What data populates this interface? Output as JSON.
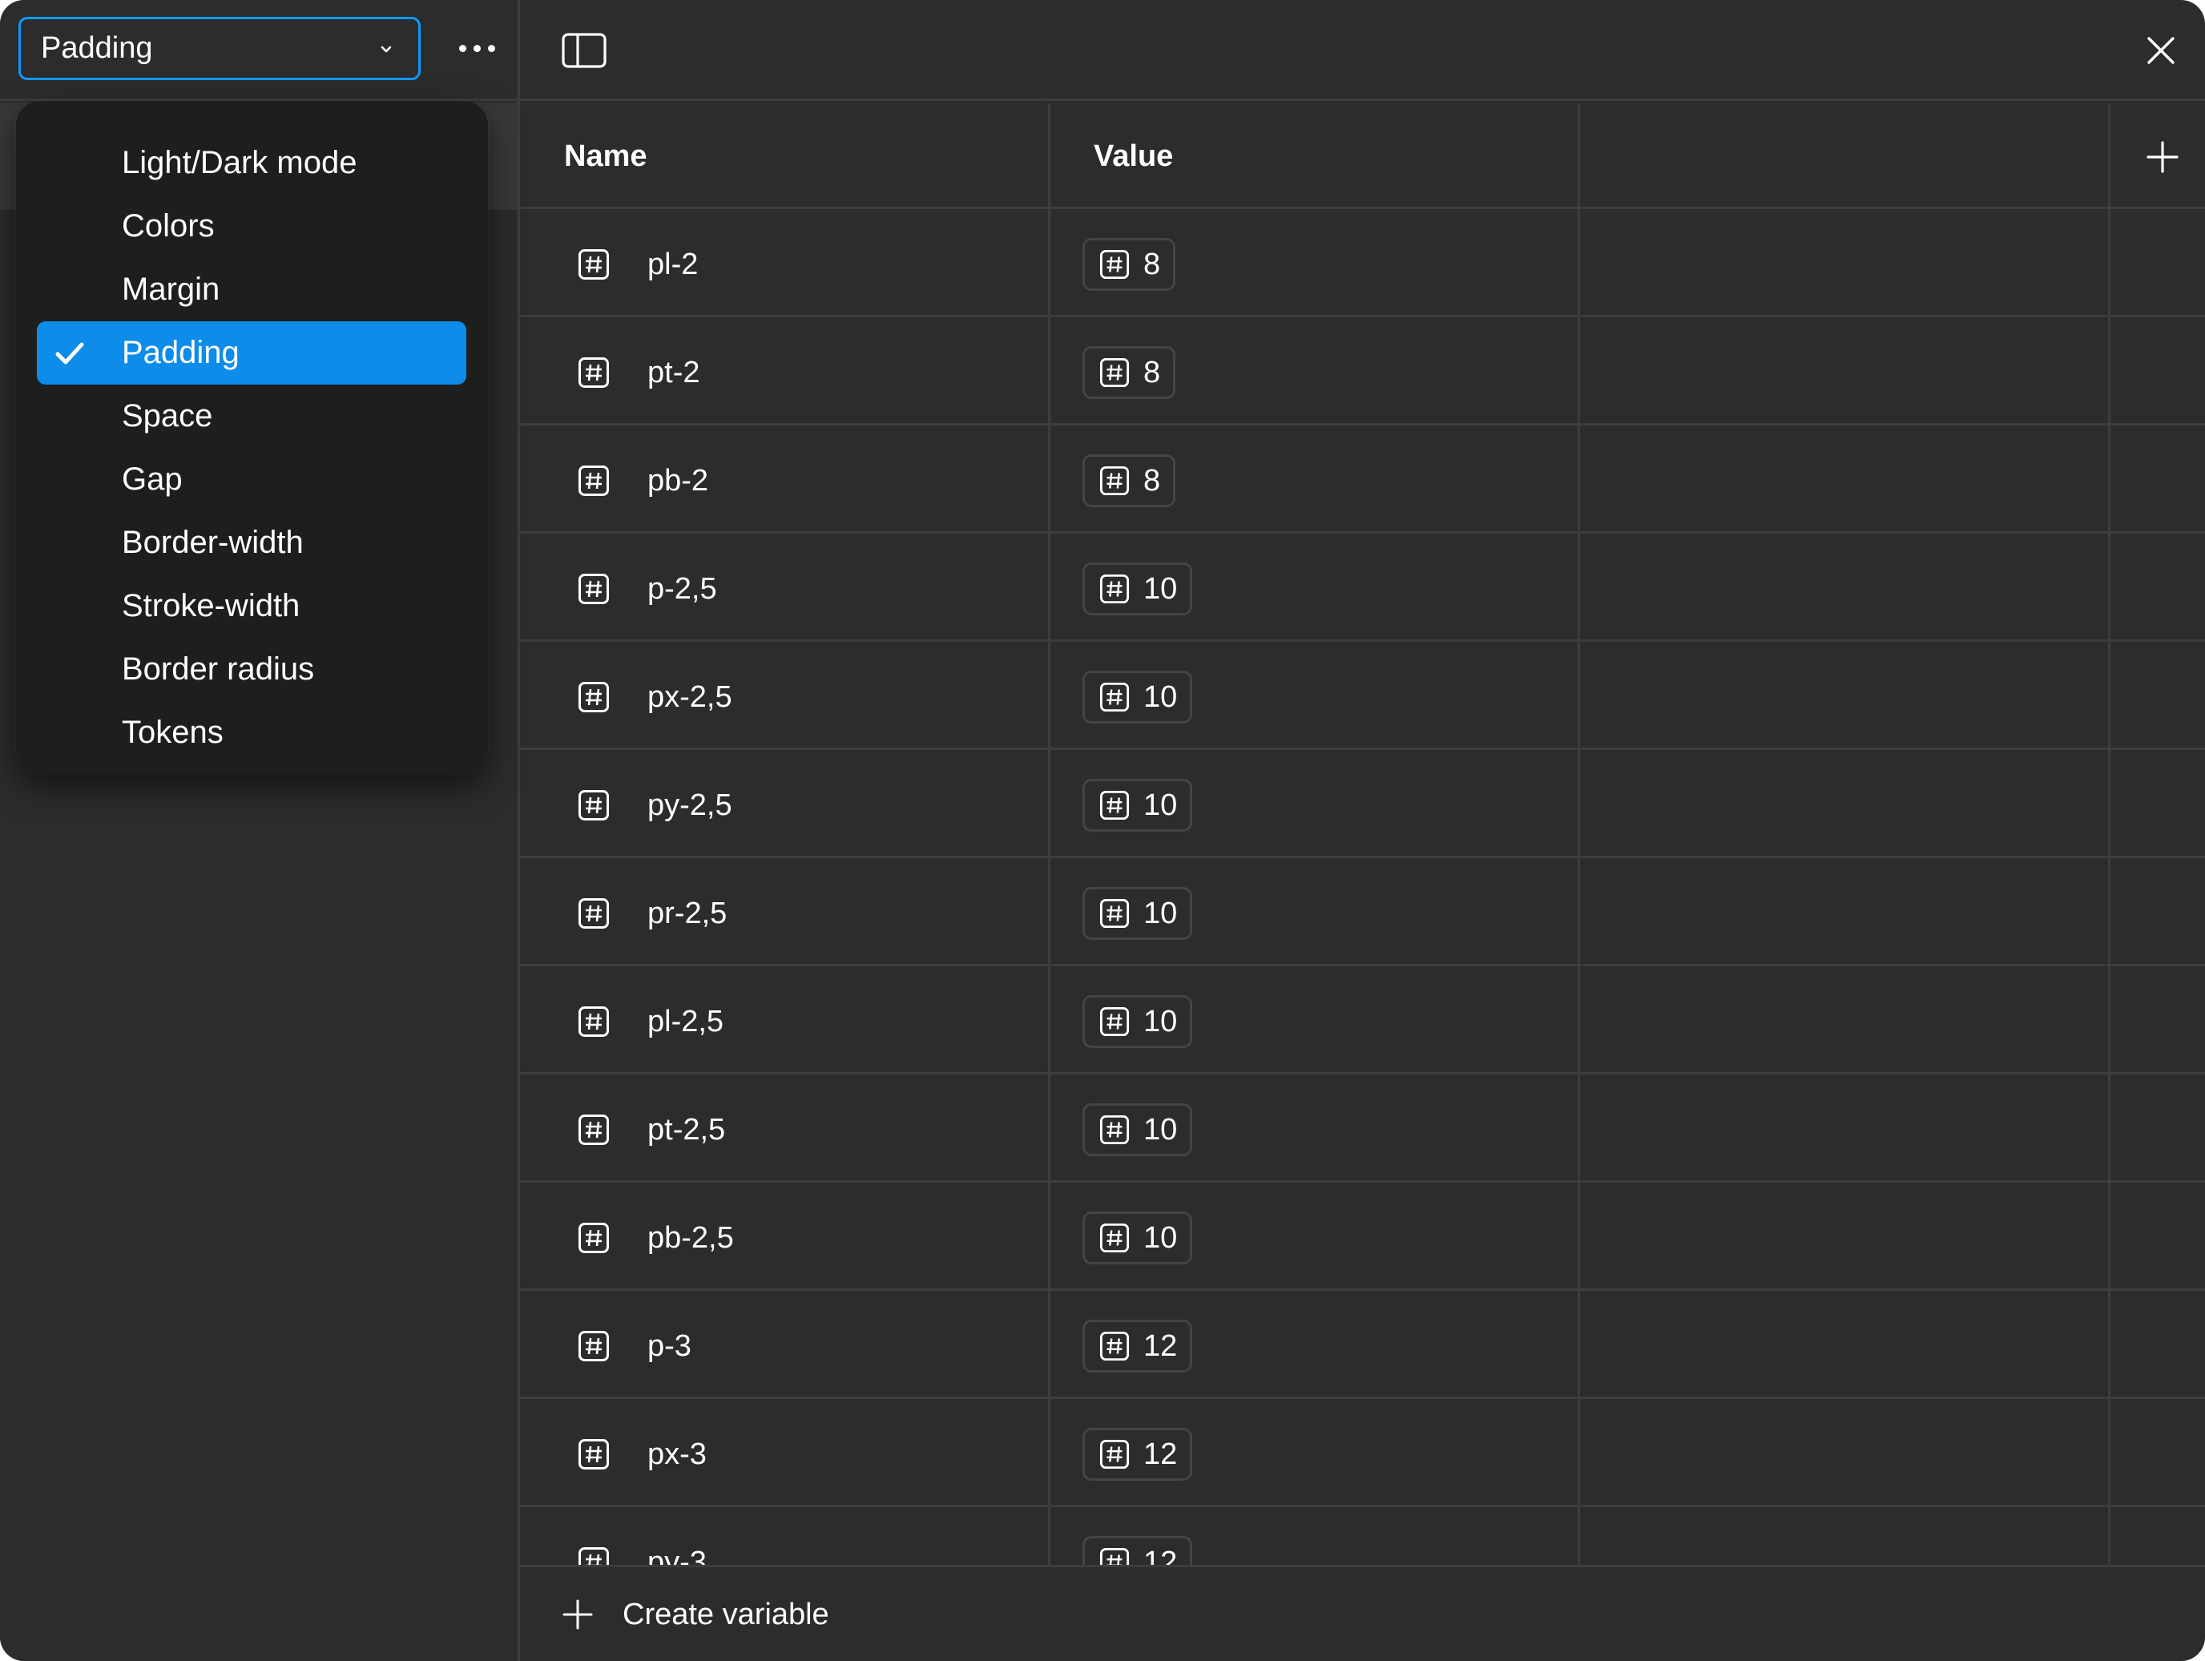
{
  "collection_select": {
    "selected": "Padding"
  },
  "menu": {
    "items": [
      {
        "label": "Light/Dark mode",
        "selected": false
      },
      {
        "label": "Colors",
        "selected": false
      },
      {
        "label": "Margin",
        "selected": false
      },
      {
        "label": "Padding",
        "selected": true
      },
      {
        "label": "Space",
        "selected": false
      },
      {
        "label": "Gap",
        "selected": false
      },
      {
        "label": "Border-width",
        "selected": false
      },
      {
        "label": "Stroke-width",
        "selected": false
      },
      {
        "label": "Border radius",
        "selected": false
      },
      {
        "label": "Tokens",
        "selected": false
      }
    ]
  },
  "table": {
    "columns": {
      "name": "Name",
      "value": "Value"
    },
    "rows": [
      {
        "name": "pl-2",
        "value": "8"
      },
      {
        "name": "pt-2",
        "value": "8"
      },
      {
        "name": "pb-2",
        "value": "8"
      },
      {
        "name": "p-2,5",
        "value": "10"
      },
      {
        "name": "px-2,5",
        "value": "10"
      },
      {
        "name": "py-2,5",
        "value": "10"
      },
      {
        "name": "pr-2,5",
        "value": "10"
      },
      {
        "name": "pl-2,5",
        "value": "10"
      },
      {
        "name": "pt-2,5",
        "value": "10"
      },
      {
        "name": "pb-2,5",
        "value": "10"
      },
      {
        "name": "p-3",
        "value": "12"
      },
      {
        "name": "px-3",
        "value": "12"
      },
      {
        "name": "py-3",
        "value": "12"
      }
    ]
  },
  "footer": {
    "create_label": "Create variable"
  },
  "colors": {
    "background": "#2c2c2c",
    "menu_background": "#1e1e1e",
    "accent": "#0d99ff",
    "selected_item": "#0d8ce9",
    "divider": "#3d3d3d"
  },
  "icons": {
    "variable_type": "number-hash-icon",
    "select": "chevron-down-icon",
    "more": "ellipsis-icon",
    "panel": "sidebar-toggle-icon",
    "close": "close-icon",
    "add": "plus-icon",
    "check": "check-icon"
  }
}
